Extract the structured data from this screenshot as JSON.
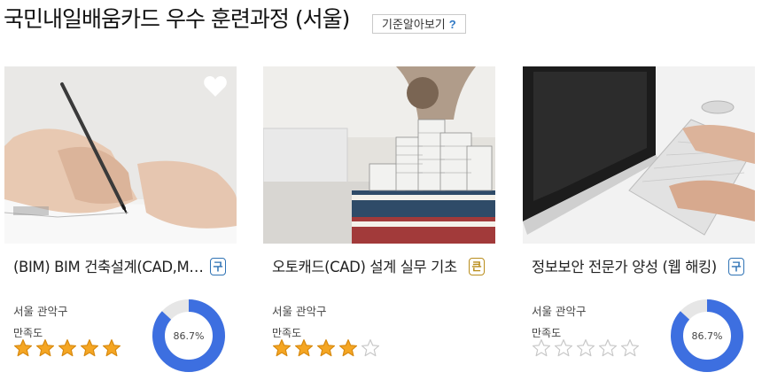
{
  "header": {
    "title": "국민내일배움카드 우수 훈련과정 (서울)",
    "criteria_button": "기준알아보기",
    "criteria_icon": "?"
  },
  "cards": [
    {
      "title": "(BIM) BIM 건축설계(CAD,MAX,Revit)",
      "badge": "구",
      "badge_color": "#2f73b5",
      "location": "서울 관악구",
      "satisfaction_label": "만족도",
      "rating": 5,
      "rating_max": 5,
      "rate": 86.7,
      "rate_label": "86.7%",
      "image": "person-drawing-with-pen"
    },
    {
      "title": "오토캐드(CAD) 설계 실무 기초",
      "badge": "큰",
      "badge_color": "#b98d1c",
      "location": "서울 관악구",
      "satisfaction_label": "만족도",
      "rating": 4,
      "rating_max": 5,
      "rate": null,
      "rate_label": "",
      "image": "architectural-model-on-books"
    },
    {
      "title": "정보보안 전문가 양성 (웹 해킹)",
      "badge": "구",
      "badge_color": "#2f73b5",
      "location": "서울 관악구",
      "satisfaction_label": "만족도",
      "rating": 0,
      "rating_max": 5,
      "rate": 86.7,
      "rate_label": "86.7%",
      "image": "hands-typing-on-keyboard"
    }
  ],
  "colors": {
    "star_filled": "#f5a623",
    "star_empty": "#c8c8c8",
    "donut_fill": "#3d6fe0",
    "donut_track": "#e6e6e6"
  }
}
